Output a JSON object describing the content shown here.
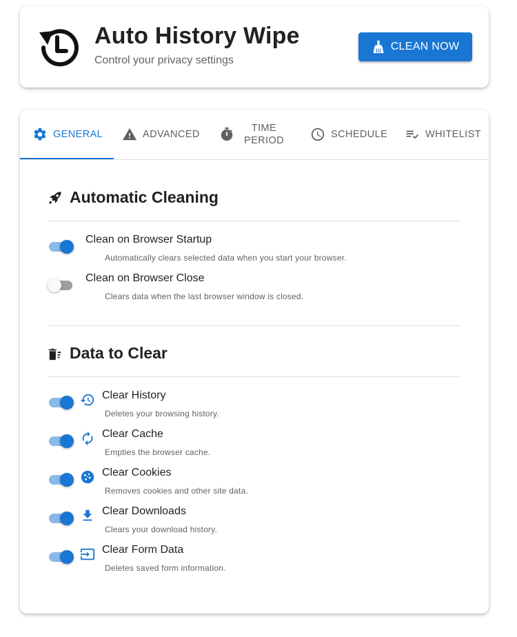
{
  "header": {
    "title": "Auto History Wipe",
    "subtitle": "Control your privacy settings",
    "clean_button": "CLEAN NOW"
  },
  "tabs": [
    {
      "label": "GENERAL",
      "icon": "gear-icon",
      "active": true
    },
    {
      "label": "ADVANCED",
      "icon": "warning-icon",
      "active": false
    },
    {
      "label_line1": "TIME",
      "label_line2": "PERIOD",
      "icon": "timer-icon",
      "active": false
    },
    {
      "label": "SCHEDULE",
      "icon": "clock-icon",
      "active": false
    },
    {
      "label": "WHITELIST",
      "icon": "playlist-check-icon",
      "active": false
    }
  ],
  "automatic_cleaning": {
    "title": "Automatic Cleaning",
    "icon": "rocket-icon",
    "options": [
      {
        "label": "Clean on Browser Startup",
        "description": "Automatically clears selected data when you start your browser.",
        "enabled": true
      },
      {
        "label": "Clean on Browser Close",
        "description": "Clears data when the last browser window is closed.",
        "enabled": false
      }
    ]
  },
  "data_to_clear": {
    "title": "Data to Clear",
    "icon": "delete-sweep-icon",
    "options": [
      {
        "label": "Clear History",
        "description": "Deletes your browsing history.",
        "icon": "history-icon",
        "enabled": true
      },
      {
        "label": "Clear Cache",
        "description": "Empties the browser cache.",
        "icon": "refresh-icon",
        "enabled": true
      },
      {
        "label": "Clear Cookies",
        "description": "Removes cookies and other site data.",
        "icon": "cookie-icon",
        "enabled": true
      },
      {
        "label": "Clear Downloads",
        "description": "Clears your download history.",
        "icon": "download-icon",
        "enabled": true
      },
      {
        "label": "Clear Form Data",
        "description": "Deletes saved form information.",
        "icon": "form-input-icon",
        "enabled": true
      }
    ]
  },
  "colors": {
    "accent": "#1976d2",
    "accent_track": "#8ab8e8",
    "text": "#212121",
    "muted": "#616161"
  }
}
